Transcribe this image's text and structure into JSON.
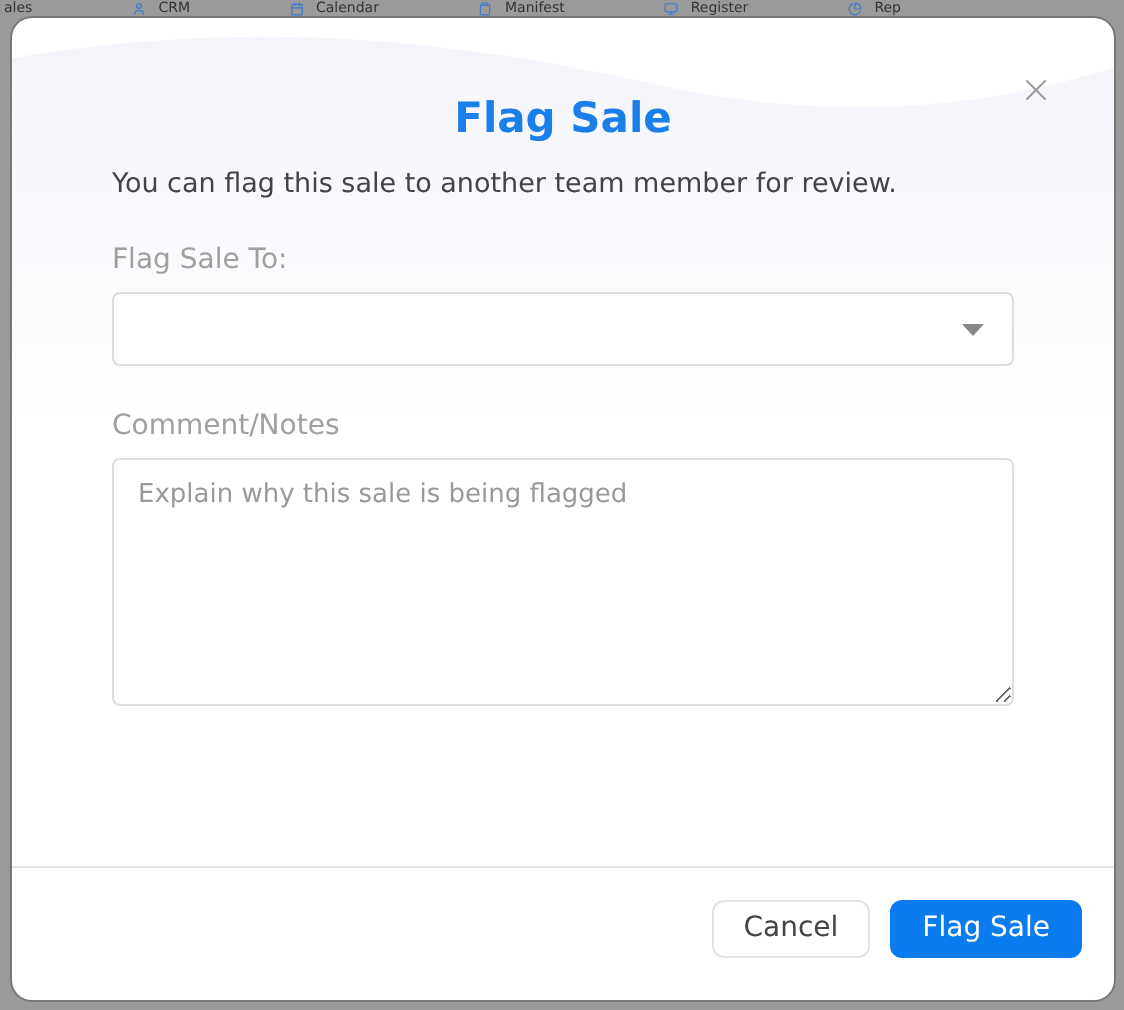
{
  "background_nav": [
    {
      "label": "ales",
      "kind": "none"
    },
    {
      "label": "CRM",
      "kind": "person"
    },
    {
      "label": "Calendar",
      "kind": "calendar"
    },
    {
      "label": "Manifest",
      "kind": "clipboard"
    },
    {
      "label": "Register",
      "kind": "register"
    },
    {
      "label": "Rep",
      "kind": "chart"
    }
  ],
  "dialog": {
    "title": "Flag Sale",
    "description": "You can flag this sale to another team member for review.",
    "fields": [
      {
        "kind": "select",
        "label": "Flag Sale To:"
      },
      {
        "kind": "textarea",
        "label": "Comment/Notes",
        "placeholder": "Explain why this sale is being flagged"
      }
    ],
    "buttons": [
      {
        "label": "Cancel",
        "kind": "secondary"
      },
      {
        "label": "Flag Sale",
        "kind": "primary"
      }
    ]
  }
}
